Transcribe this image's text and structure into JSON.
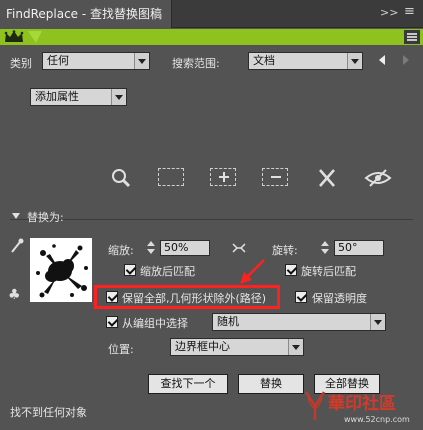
{
  "panel": {
    "title": "FindReplace - 查找替换图稿",
    "collapse_glyph": ">>",
    "close_glyph": "×"
  },
  "search": {
    "category_label": "类别",
    "category_value": "任何",
    "scope_label": "搜索范围:",
    "scope_value": "文档",
    "add_attribute_label": "添加属性"
  },
  "tools": [
    "zoom-icon",
    "select-rect-icon",
    "add-to-selection-icon",
    "subtract-selection-icon",
    "close-icon",
    "hide-eye-icon"
  ],
  "replace": {
    "section_title": "替换为:",
    "scale_label": "缩放:",
    "scale_value": "50%",
    "rotate_label": "旋转:",
    "rotate_value": "50°",
    "scale_after_match": "缩放后匹配",
    "rotate_after_match": "旋转后匹配",
    "keep_all_label": "保留全部,几何形状除外(路径)",
    "keep_opacity_label": "保留透明度",
    "choose_from_group_label": "从编组中选择",
    "choose_from_group_value": "随机",
    "position_label": "位置:",
    "position_value": "边界框中心"
  },
  "buttons": {
    "find_next": "查找下一个",
    "replace": "替换",
    "replace_all": "全部替换"
  },
  "status": "找不到任何对象",
  "watermark": {
    "brand": "華印社區",
    "url": "www.52cnp.com"
  },
  "colors": {
    "panel_bg": "#535353",
    "accent_green": "#8dc21f",
    "highlight_red": "#ff2020"
  }
}
